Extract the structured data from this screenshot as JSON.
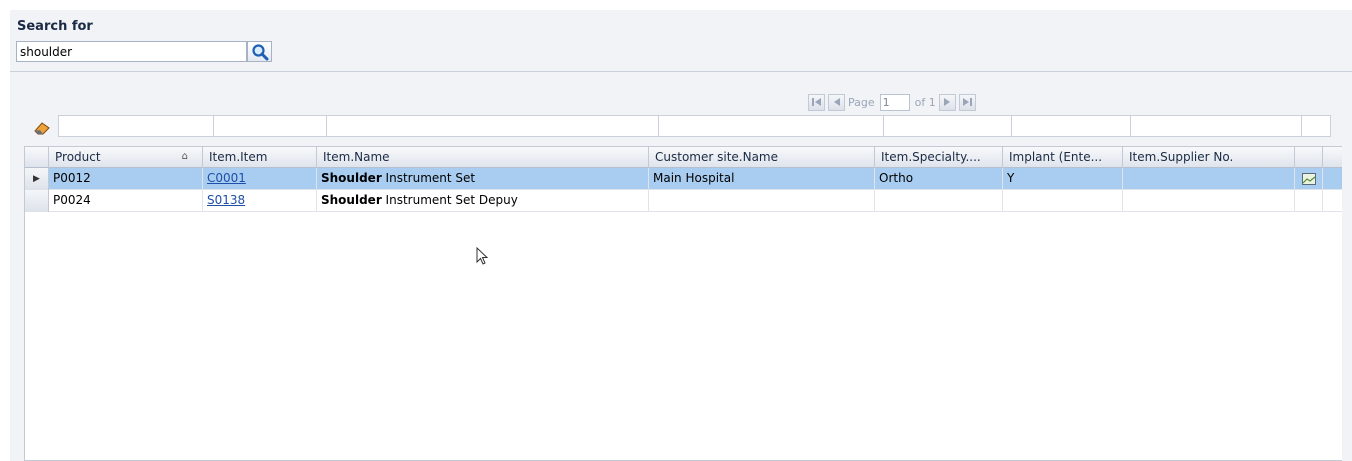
{
  "search": {
    "title": "Search for",
    "value": "shoulder"
  },
  "pager": {
    "page_label": "Page",
    "page_value": "1",
    "of_label": "of 1"
  },
  "columns": [
    {
      "key": "product",
      "label": "Product",
      "sortable_icon": "sort-icon"
    },
    {
      "key": "item",
      "label": "Item.Item"
    },
    {
      "key": "name",
      "label": "Item.Name"
    },
    {
      "key": "site",
      "label": "Customer site.Name"
    },
    {
      "key": "specialty",
      "label": "Item.Specialty...."
    },
    {
      "key": "implant",
      "label": "Implant (Ente..."
    },
    {
      "key": "supplier",
      "label": "Item.Supplier No."
    }
  ],
  "rows": [
    {
      "selected": true,
      "product": "P0012",
      "item": "C0001",
      "name_bold": "Shoulder",
      "name_rest": " Instrument Set",
      "site": "Main Hospital",
      "specialty": "Ortho",
      "implant": "Y",
      "supplier": "",
      "has_image_icon": true
    },
    {
      "selected": false,
      "product": "P0024",
      "item": "S0138",
      "name_bold": "Shoulder",
      "name_rest": " Instrument Set Depuy",
      "site": "",
      "specialty": "",
      "implant": "",
      "supplier": "",
      "has_image_icon": false
    }
  ],
  "colors": {
    "selected_row": "#a8cdf1",
    "link": "#1f4fa8",
    "panel_bg": "#f1f3f7"
  }
}
